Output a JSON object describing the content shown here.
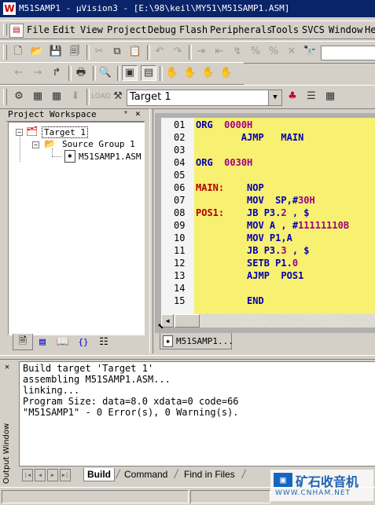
{
  "window": {
    "title": "M51SAMP1  - μVision3 - [E:\\98\\keil\\MY51\\M51SAMP1.ASM]",
    "app_icon": "W"
  },
  "menu": [
    "File",
    "Edit",
    "View",
    "Project",
    "Debug",
    "Flash",
    "Peripherals",
    "Tools",
    "SVCS",
    "Window",
    "He"
  ],
  "build_toolbar": {
    "target_select": "Target 1"
  },
  "workspace": {
    "title": "Project Workspace",
    "tree": {
      "target": "Target 1",
      "group": "Source Group 1",
      "file": "M51SAMP1.ASM"
    },
    "tab_icons": [
      "files-tab-icon",
      "regs-tab-icon",
      "books-tab-icon",
      "functions-tab-icon",
      "templates-tab-icon"
    ]
  },
  "editor": {
    "tab_label": "M51SAMP1...",
    "lines": [
      {
        "n": "01",
        "parts": [
          [
            "kw",
            "ORG"
          ],
          [
            "",
            "  "
          ],
          [
            "num",
            "0000H"
          ]
        ]
      },
      {
        "n": "02",
        "parts": [
          [
            "",
            "        "
          ],
          [
            "kw",
            "AJMP"
          ],
          [
            "",
            "   "
          ],
          [
            "kw",
            "MAIN"
          ]
        ]
      },
      {
        "n": "03",
        "parts": []
      },
      {
        "n": "04",
        "parts": [
          [
            "kw",
            "ORG"
          ],
          [
            "",
            "  "
          ],
          [
            "num",
            "0030H"
          ]
        ]
      },
      {
        "n": "05",
        "parts": []
      },
      {
        "n": "06",
        "parts": [
          [
            "lbl",
            "MAIN:"
          ],
          [
            "",
            "    "
          ],
          [
            "kw",
            "NOP"
          ]
        ]
      },
      {
        "n": "07",
        "parts": [
          [
            "",
            "         "
          ],
          [
            "kw",
            "MOV"
          ],
          [
            "",
            "  "
          ],
          [
            "kw",
            "SP,#"
          ],
          [
            "num",
            "30H"
          ]
        ]
      },
      {
        "n": "08",
        "parts": [
          [
            "lbl",
            "POS1:"
          ],
          [
            "",
            "    "
          ],
          [
            "kw",
            "JB P3."
          ],
          [
            "num",
            "2"
          ],
          [
            "kw",
            " , $"
          ]
        ]
      },
      {
        "n": "09",
        "parts": [
          [
            "",
            "         "
          ],
          [
            "kw",
            "MOV A , #"
          ],
          [
            "num",
            "11111110B"
          ]
        ]
      },
      {
        "n": "10",
        "parts": [
          [
            "",
            "         "
          ],
          [
            "kw",
            "MOV P1,A"
          ]
        ]
      },
      {
        "n": "11",
        "parts": [
          [
            "",
            "         "
          ],
          [
            "kw",
            "JB P3."
          ],
          [
            "num",
            "3"
          ],
          [
            "kw",
            " , $"
          ]
        ]
      },
      {
        "n": "12",
        "parts": [
          [
            "",
            "         "
          ],
          [
            "kw",
            "SETB P1."
          ],
          [
            "num",
            "0"
          ]
        ]
      },
      {
        "n": "13",
        "parts": [
          [
            "",
            "         "
          ],
          [
            "kw",
            "AJMP"
          ],
          [
            "",
            "  "
          ],
          [
            "kw",
            "POS1"
          ]
        ]
      },
      {
        "n": "14",
        "parts": []
      },
      {
        "n": "15",
        "parts": [
          [
            "",
            "         "
          ],
          [
            "kw",
            "END"
          ]
        ]
      }
    ]
  },
  "output": {
    "side_title": "Output Window",
    "lines": [
      "Build target 'Target 1'",
      "assembling M51SAMP1.ASM...",
      "linking...",
      "Program Size: data=8.0 xdata=0 code=66",
      "\"M51SAMP1\" - 0 Error(s), 0 Warning(s)."
    ],
    "tabs": [
      "Build",
      "Command",
      "Find in Files"
    ],
    "active_tab": "Build"
  },
  "watermark": {
    "text": "矿石收音机",
    "url": "WWW.CNHAM.NET"
  },
  "colors": {
    "titlebar": "#0a246a",
    "editor_bg": "#f8f070",
    "label": "#b00000",
    "keyword": "#0000b0",
    "number": "#a00080"
  }
}
